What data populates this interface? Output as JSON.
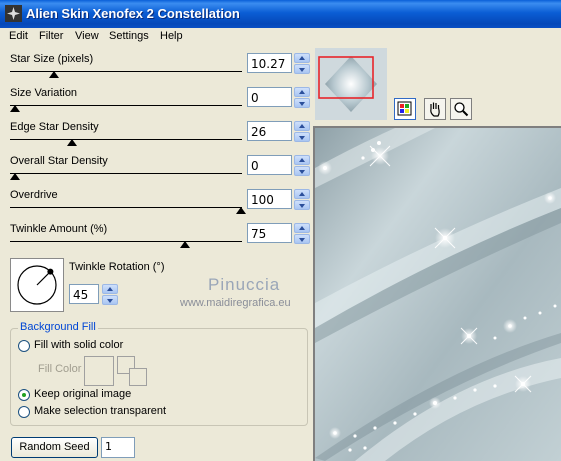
{
  "window": {
    "title": "Alien Skin Xenofex 2 Constellation"
  },
  "menu": [
    "Edit",
    "Filter",
    "View",
    "Settings",
    "Help"
  ],
  "params": [
    {
      "label": "Star Size (pixels)",
      "value": "10.27",
      "level": 0.19
    },
    {
      "label": "Size Variation",
      "value": "0",
      "level": 0.02
    },
    {
      "label": "Edge Star Density",
      "value": "26",
      "level": 0.26
    },
    {
      "label": "Overall Star Density",
      "value": "0",
      "level": 0.02
    },
    {
      "label": "Overdrive",
      "value": "100",
      "level": 1.0
    },
    {
      "label": "Twinkle Amount (%)",
      "value": "75",
      "level": 0.75
    }
  ],
  "rotation": {
    "label": "Twinkle Rotation (°)",
    "value": "45"
  },
  "background_fill": {
    "title": "Background Fill",
    "fill_solid_label": "Fill with solid color",
    "fill_color_label": "Fill Color",
    "keep_original_label": "Keep original image",
    "transparent_label": "Make selection transparent",
    "selected": "keep_original"
  },
  "random_seed": {
    "button_label": "Random Seed",
    "value": "1"
  },
  "watermark": {
    "line1": "Pinuccia",
    "line2": "www.maidiregrafica.eu"
  },
  "icons": {
    "app": "app-icon",
    "tools": [
      "color-picker-icon",
      "hand-pan-icon",
      "magnifier-zoom-icon"
    ]
  },
  "colors": {
    "titlebar": "#0a5fd8",
    "window_bg": "#ece9d8",
    "group_title": "#0046d5"
  }
}
